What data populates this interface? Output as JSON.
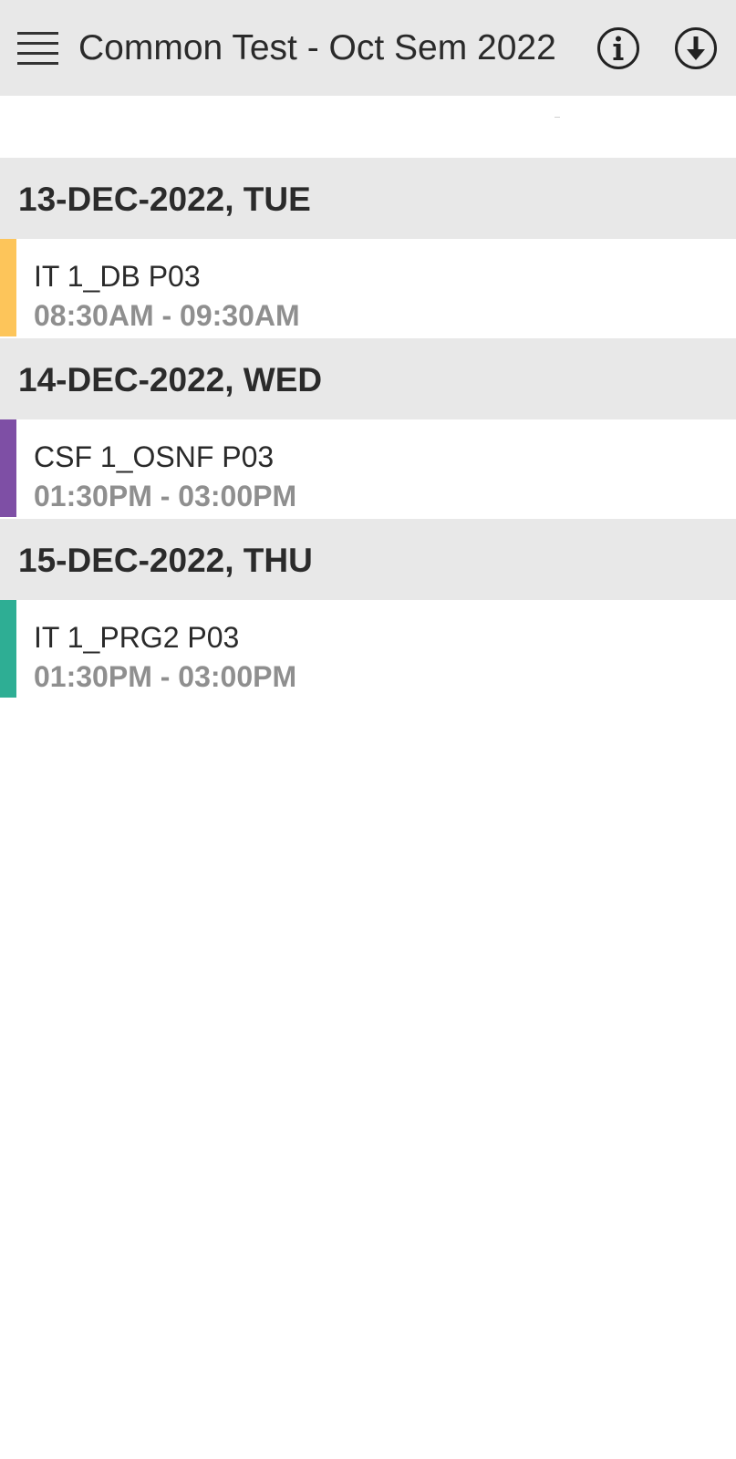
{
  "header": {
    "title": "Common Test - Oct Sem 2022",
    "menu_icon": "hamburger-menu-icon",
    "info_icon": "info-icon",
    "download_icon": "download-icon"
  },
  "schedule": [
    {
      "date": "13-DEC-2022, TUE",
      "events": [
        {
          "name": "IT 1_DB P03",
          "time": "08:30AM - 09:30AM",
          "color": "#FDC55A"
        }
      ]
    },
    {
      "date": "14-DEC-2022, WED",
      "events": [
        {
          "name": "CSF 1_OSNF P03",
          "time": "01:30PM - 03:00PM",
          "color": "#7E4FA5"
        }
      ]
    },
    {
      "date": "15-DEC-2022, THU",
      "events": [
        {
          "name": "IT 1_PRG2 P03",
          "time": "01:30PM - 03:00PM",
          "color": "#2EAE94"
        }
      ]
    }
  ]
}
